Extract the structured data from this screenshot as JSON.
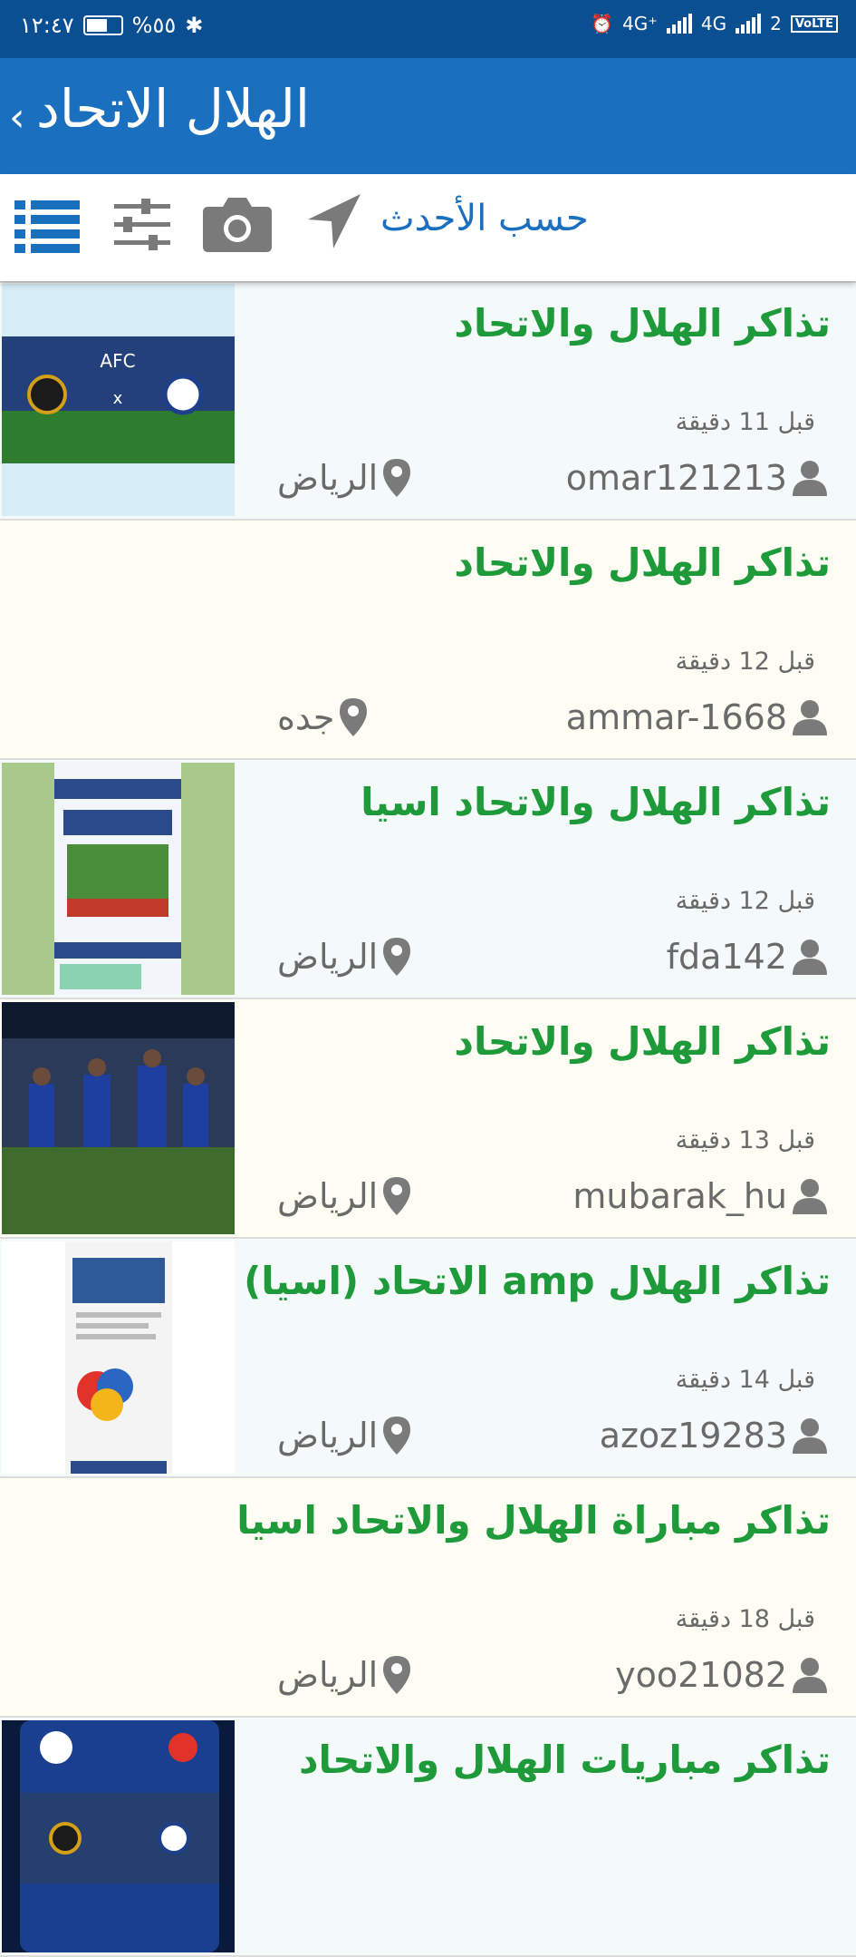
{
  "status_bar": {
    "time": "١٢:٤٧",
    "battery": "%٥٥",
    "network_1": "4G⁺",
    "network_2": "4G",
    "sim": "2",
    "volte": "VoLTE"
  },
  "app_bar": {
    "title": "الهلال الاتحاد"
  },
  "toolbar": {
    "sort_label": "حسب الأحدث"
  },
  "colors": {
    "app_bar": "#1a6fbf",
    "status_bar": "#0a4f92",
    "title_green": "#1f9a3a"
  },
  "listings": [
    {
      "title": "تذاكر الهلال والاتحاد",
      "time": "قبل 11 دقيقة",
      "user": "omar121213",
      "location": "الرياض",
      "bg": "#f4f9f9",
      "thumb": "afc"
    },
    {
      "title": "تذاكر الهلال والاتحاد",
      "time": "قبل 12 دقيقة",
      "user": "ammar-1668",
      "location": "جده",
      "bg": "#fdfdf4",
      "thumb": "none"
    },
    {
      "title": "تذاكر الهلال والاتحاد اسيا",
      "time": "قبل 12 دقيقة",
      "user": "fda142",
      "location": "الرياض",
      "bg": "#f4f9f9",
      "thumb": "stadium"
    },
    {
      "title": "تذاكر الهلال والاتحاد",
      "time": "قبل 13 دقيقة",
      "user": "mubarak_hu",
      "location": "الرياض",
      "bg": "#fdfdf4",
      "thumb": "players"
    },
    {
      "title": "تذاكر الهلال  amp  الاتحاد (اسيا)",
      "time": "قبل 14 دقيقة",
      "user": "azoz19283",
      "location": "الرياض",
      "bg": "#f4f9f9",
      "thumb": "champions"
    },
    {
      "title": "تذاكر مباراة الهلال والاتحاد اسيا",
      "time": "قبل 18 دقيقة",
      "user": "yoo21082",
      "location": "الرياض",
      "bg": "#fdfdf4",
      "thumb": "none"
    },
    {
      "title": "تذاكر مباريات الهلال والاتحاد",
      "time": "",
      "user": "",
      "location": "",
      "bg": "#f4f9f9",
      "thumb": "afc2"
    }
  ]
}
